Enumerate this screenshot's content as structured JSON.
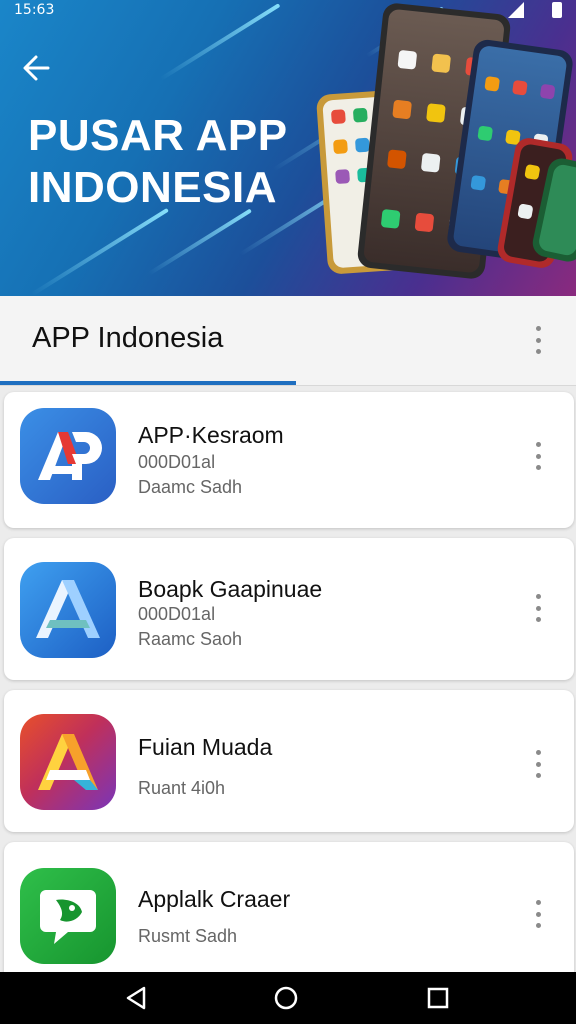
{
  "status_bar": {
    "time": "15:63"
  },
  "banner": {
    "title_line1": "PUSAR APP",
    "title_line2": "INDONESIA",
    "background": "#1a86c9"
  },
  "tab": {
    "title": "APP Indonesia",
    "accent": "#1f6fc0"
  },
  "apps": [
    {
      "name": "APP·Kesraom",
      "line1": "000D01al",
      "line2": "Daamc Sadh",
      "icon": "ap-logo-icon"
    },
    {
      "name": "Boapk Gaapinuae",
      "line1": "000D01al",
      "line2": "Raamc Saoh",
      "icon": "a-logo-blue-icon"
    },
    {
      "name": "Fuian Muada",
      "line1": "",
      "line2": "Ruant 4i0h",
      "icon": "a-logo-gradient-icon"
    },
    {
      "name": "Applalk Craaer",
      "line1": "",
      "line2": "Rusmt Sadh",
      "icon": "chat-face-icon"
    }
  ],
  "nav": {
    "back": "back-triangle-icon",
    "home": "home-circle-icon",
    "recents": "recents-square-icon"
  }
}
